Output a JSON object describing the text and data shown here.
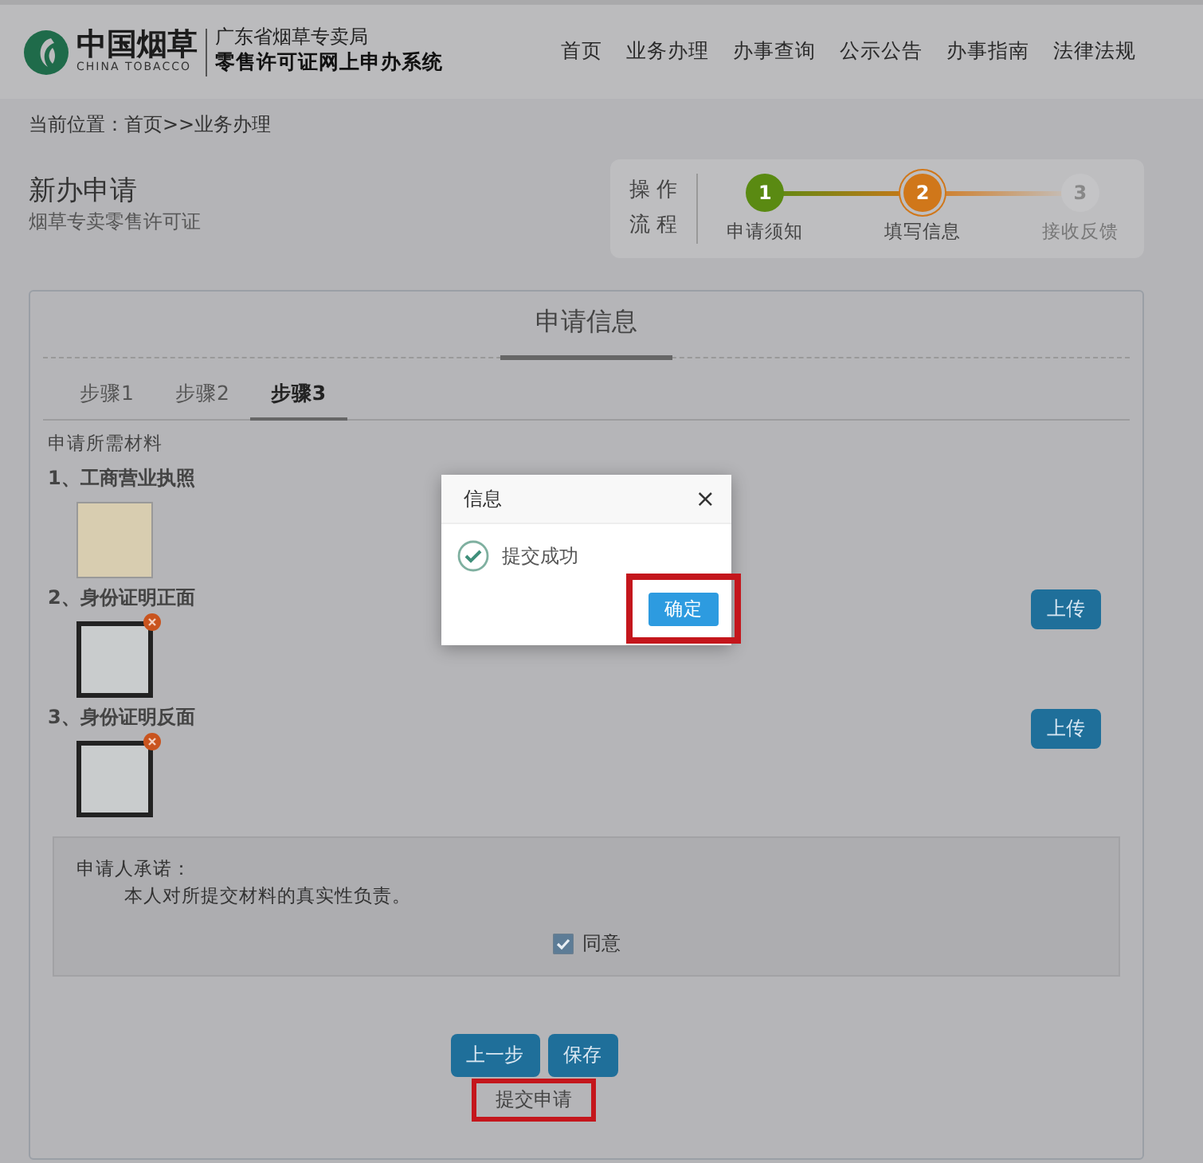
{
  "header": {
    "logo_cn": "中国烟草",
    "logo_en": "CHINA TOBACCO",
    "org": "广东省烟草专卖局",
    "system": "零售许可证网上申办系统",
    "nav": [
      {
        "label": "首页"
      },
      {
        "label": "业务办理"
      },
      {
        "label": "办事查询"
      },
      {
        "label": "公示公告"
      },
      {
        "label": "办事指南"
      },
      {
        "label": "法律法规"
      }
    ]
  },
  "breadcrumb": "当前位置：首页>>业务办理",
  "page_title": "新办申请",
  "page_subtitle": "烟草专卖零售许可证",
  "process": {
    "label_top": "操 作",
    "label_bottom": "流 程",
    "steps": [
      {
        "number": "1",
        "label": "申请须知",
        "color": "#5a8a12",
        "selected": false
      },
      {
        "number": "2",
        "label": "填写信息",
        "color": "#d0771a",
        "selected": true
      },
      {
        "number": "3",
        "label": "接收反馈",
        "color": "#c4c4c6",
        "selected": false
      }
    ]
  },
  "card": {
    "heading": "申请信息",
    "tabs": [
      {
        "label": "步骤1",
        "selected": false
      },
      {
        "label": "步骤2",
        "selected": false
      },
      {
        "label": "步骤3",
        "selected": true
      }
    ],
    "section_label": "申请所需材料",
    "materials": [
      {
        "label": "1、工商营业执照",
        "kind": "license",
        "removable": false
      },
      {
        "label": "2、身份证明正面",
        "kind": "idcard",
        "removable": true,
        "upload": "上传"
      },
      {
        "label": "3、身份证明反面",
        "kind": "idcard",
        "removable": true,
        "upload": "上传"
      }
    ],
    "pledge": {
      "title": "申请人承诺：",
      "text": "本人对所提交材料的真实性负责。",
      "agree_label": "同意",
      "checked": true
    },
    "buttons": [
      {
        "label": "上一步"
      },
      {
        "label": "保存"
      }
    ],
    "submit": {
      "label": "提交申请",
      "highlighted": true
    }
  },
  "dialog": {
    "title": "信息",
    "close": "×",
    "message": "提交成功",
    "confirm": {
      "label": "确定",
      "highlighted": true
    }
  }
}
